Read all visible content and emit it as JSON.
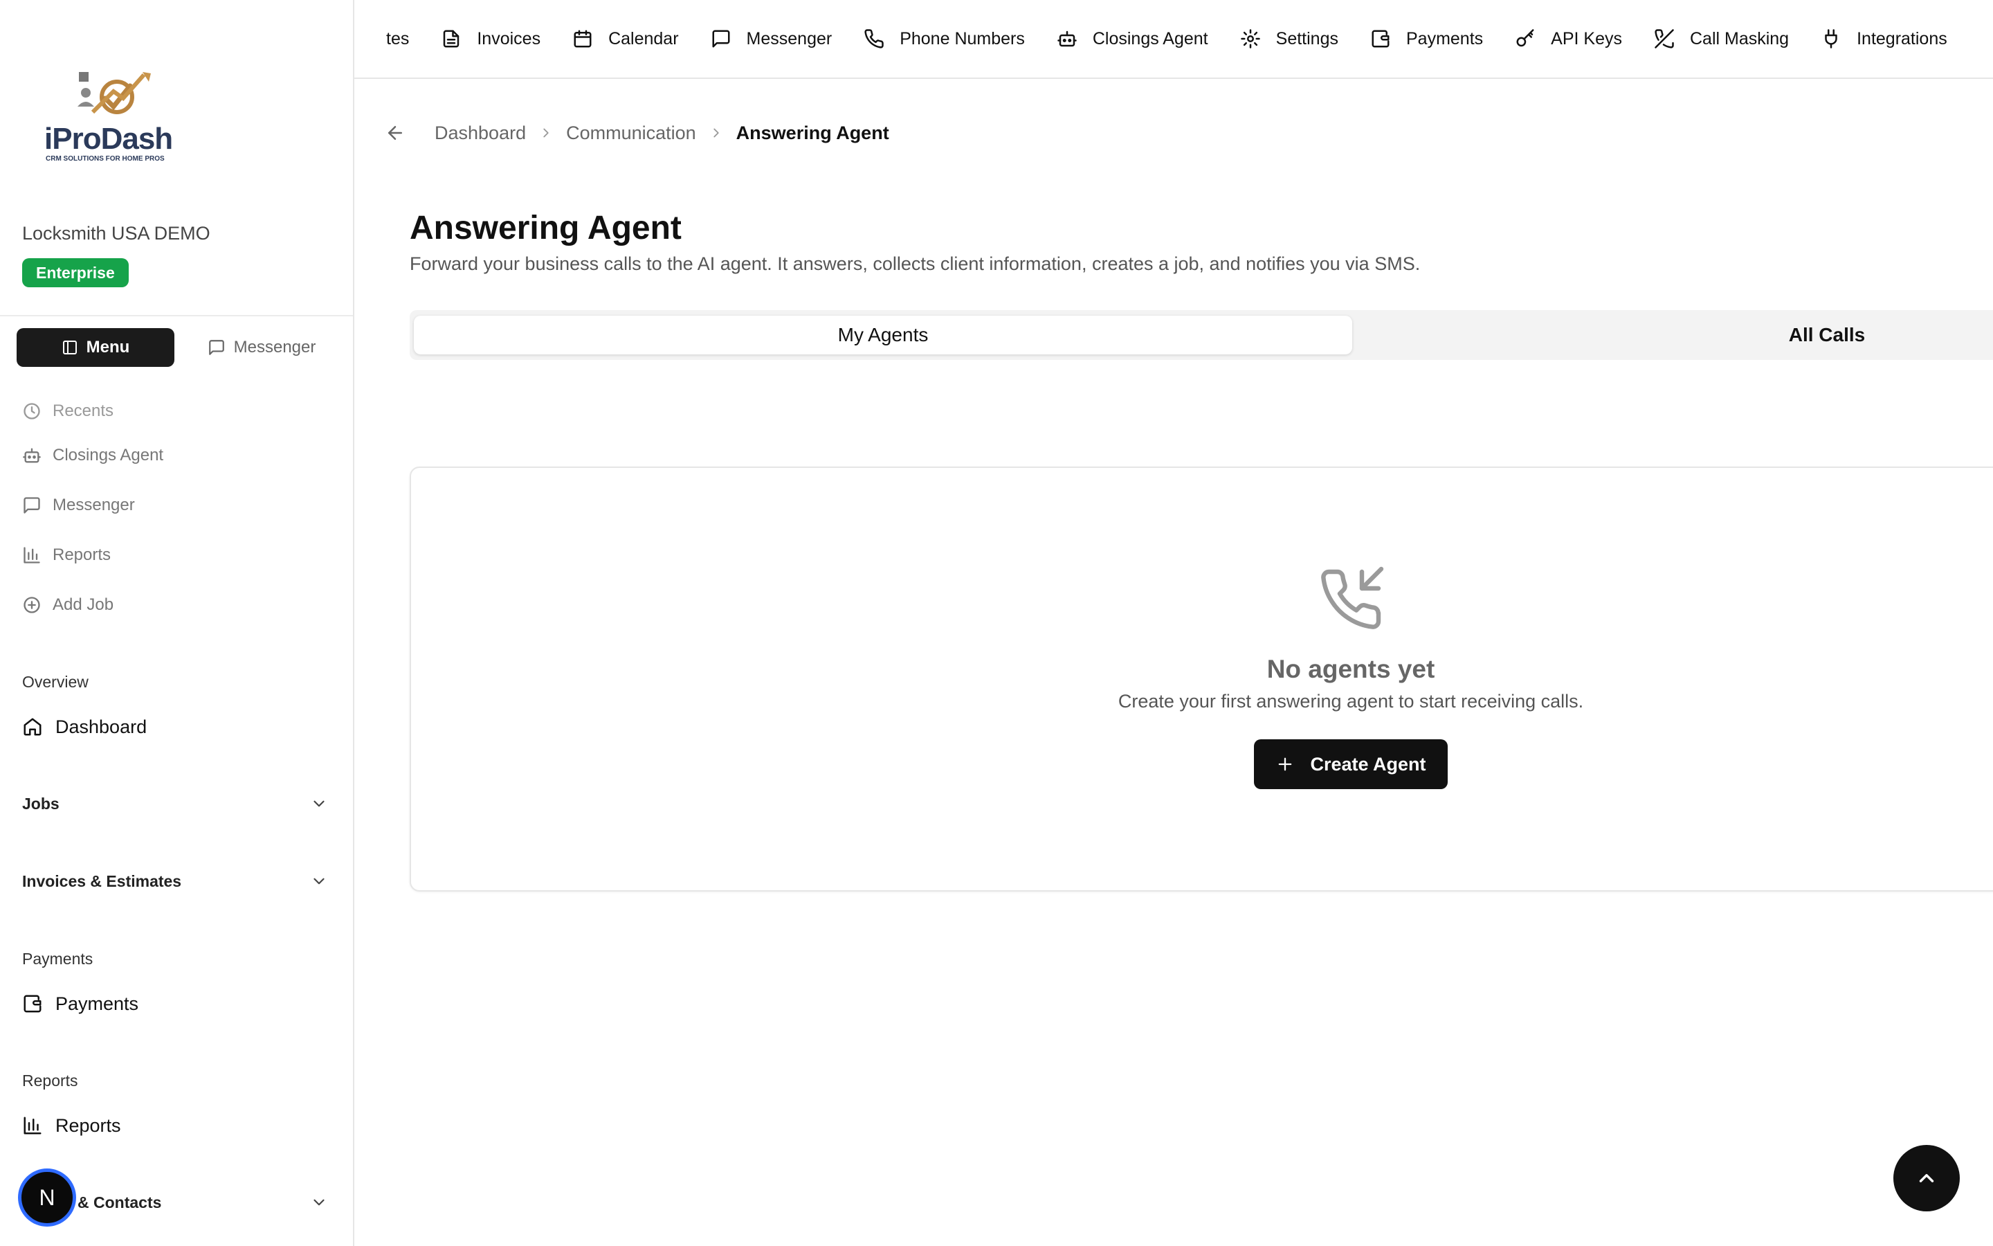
{
  "brand": {
    "name": "iProDash",
    "tagline": "CRM SOLUTIONS FOR HOME PROS",
    "accent": "#b9843f"
  },
  "account": {
    "company": "Locksmith USA DEMO",
    "plan": "Enterprise",
    "plan_color": "#16a34a"
  },
  "sidebar": {
    "toggle": {
      "menu": "Menu",
      "messenger": "Messenger"
    },
    "quick": [
      {
        "label": "Recents",
        "icon": "clock-icon"
      },
      {
        "label": "Closings Agent",
        "icon": "bot-icon"
      },
      {
        "label": "Messenger",
        "icon": "message-square-icon"
      },
      {
        "label": "Reports",
        "icon": "bar-chart-icon"
      },
      {
        "label": "Add Job",
        "icon": "plus-circle-icon"
      }
    ],
    "sections": {
      "overview": "Overview",
      "dashboard": "Dashboard",
      "jobs": "Jobs",
      "invoices_estimates": "Invoices & Estimates",
      "payments_heading": "Payments",
      "payments": "Payments",
      "reports_heading": "Reports",
      "reports": "Reports",
      "contacts": "& Contacts"
    },
    "avatar_initial": "N"
  },
  "topnav": [
    {
      "label": "tes",
      "icon": ""
    },
    {
      "label": "Invoices",
      "icon": "file-text-icon"
    },
    {
      "label": "Calendar",
      "icon": "calendar-icon"
    },
    {
      "label": "Messenger",
      "icon": "message-square-icon"
    },
    {
      "label": "Phone Numbers",
      "icon": "phone-icon"
    },
    {
      "label": "Closings Agent",
      "icon": "bot-icon"
    },
    {
      "label": "Settings",
      "icon": "gear-icon"
    },
    {
      "label": "Payments",
      "icon": "wallet-icon"
    },
    {
      "label": "API Keys",
      "icon": "key-icon"
    },
    {
      "label": "Call Masking",
      "icon": "phone-off-icon"
    },
    {
      "label": "Integrations",
      "icon": "plug-icon"
    }
  ],
  "breadcrumb": {
    "items": [
      "Dashboard",
      "Communication"
    ],
    "current": "Answering Agent"
  },
  "page": {
    "title": "Answering Agent",
    "subtitle": "Forward your business calls to the AI agent. It answers, collects client information, creates a job, and notifies you via SMS."
  },
  "tabs": [
    {
      "label": "My Agents",
      "active": true
    },
    {
      "label": "All Calls",
      "active": false
    }
  ],
  "empty_state": {
    "icon": "phone-incoming-icon",
    "title": "No agents yet",
    "description": "Create your first answering agent to start receiving calls.",
    "button": "Create Agent"
  }
}
